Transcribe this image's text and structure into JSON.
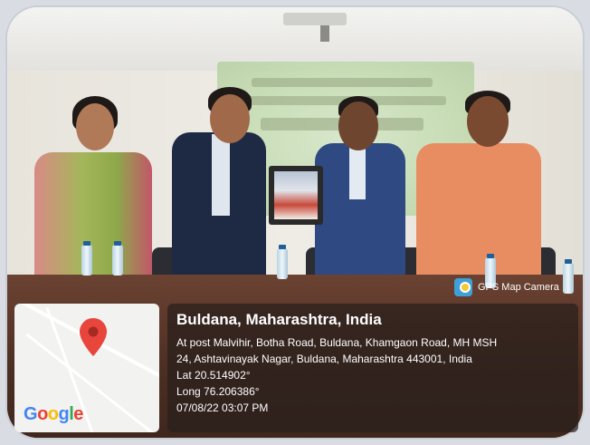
{
  "photo": {
    "description_tag": "photo"
  },
  "gps_overlay": {
    "app_label": "GPS Map Camera",
    "location_title": "Buldana, Maharashtra, India",
    "address_line1": "At post Malvihir, Botha Road, Buldana, Khamgaon Road, MH MSH",
    "address_line2": "24, Ashtavinayak Nagar, Buldana, Maharashtra 443001, India",
    "latitude": "Lat 20.514902°",
    "longitude": "Long 76.206386°",
    "datetime": "07/08/22 03:07 PM",
    "map_brand": "Google",
    "pin_color": "#e8453c"
  }
}
